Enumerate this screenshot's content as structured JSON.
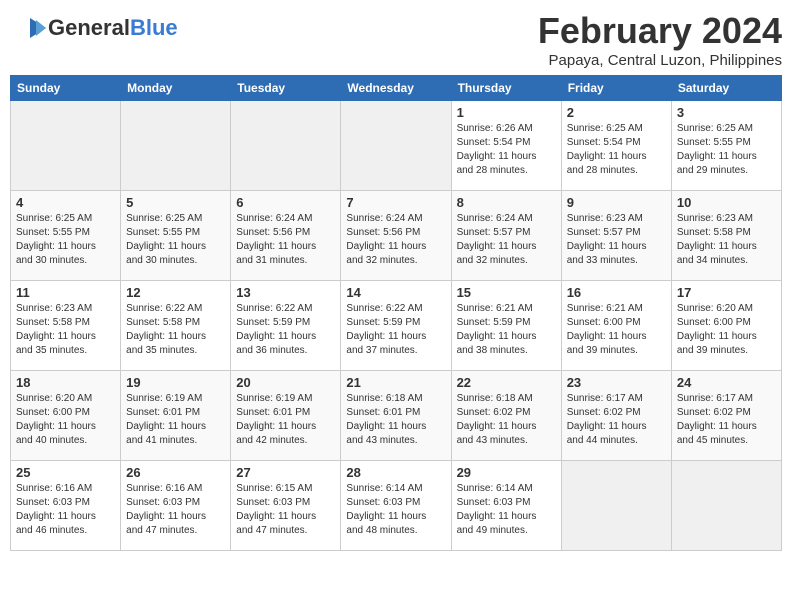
{
  "header": {
    "logo_general": "General",
    "logo_blue": "Blue",
    "month_title": "February 2024",
    "location": "Papaya, Central Luzon, Philippines"
  },
  "days_of_week": [
    "Sunday",
    "Monday",
    "Tuesday",
    "Wednesday",
    "Thursday",
    "Friday",
    "Saturday"
  ],
  "weeks": [
    [
      {
        "day": "",
        "sunrise": "",
        "sunset": "",
        "daylight": "",
        "empty": true
      },
      {
        "day": "",
        "sunrise": "",
        "sunset": "",
        "daylight": "",
        "empty": true
      },
      {
        "day": "",
        "sunrise": "",
        "sunset": "",
        "daylight": "",
        "empty": true
      },
      {
        "day": "",
        "sunrise": "",
        "sunset": "",
        "daylight": "",
        "empty": true
      },
      {
        "day": "1",
        "sunrise": "Sunrise: 6:26 AM",
        "sunset": "Sunset: 5:54 PM",
        "daylight": "Daylight: 11 hours and 28 minutes."
      },
      {
        "day": "2",
        "sunrise": "Sunrise: 6:25 AM",
        "sunset": "Sunset: 5:54 PM",
        "daylight": "Daylight: 11 hours and 28 minutes."
      },
      {
        "day": "3",
        "sunrise": "Sunrise: 6:25 AM",
        "sunset": "Sunset: 5:55 PM",
        "daylight": "Daylight: 11 hours and 29 minutes."
      }
    ],
    [
      {
        "day": "4",
        "sunrise": "Sunrise: 6:25 AM",
        "sunset": "Sunset: 5:55 PM",
        "daylight": "Daylight: 11 hours and 30 minutes."
      },
      {
        "day": "5",
        "sunrise": "Sunrise: 6:25 AM",
        "sunset": "Sunset: 5:55 PM",
        "daylight": "Daylight: 11 hours and 30 minutes."
      },
      {
        "day": "6",
        "sunrise": "Sunrise: 6:24 AM",
        "sunset": "Sunset: 5:56 PM",
        "daylight": "Daylight: 11 hours and 31 minutes."
      },
      {
        "day": "7",
        "sunrise": "Sunrise: 6:24 AM",
        "sunset": "Sunset: 5:56 PM",
        "daylight": "Daylight: 11 hours and 32 minutes."
      },
      {
        "day": "8",
        "sunrise": "Sunrise: 6:24 AM",
        "sunset": "Sunset: 5:57 PM",
        "daylight": "Daylight: 11 hours and 32 minutes."
      },
      {
        "day": "9",
        "sunrise": "Sunrise: 6:23 AM",
        "sunset": "Sunset: 5:57 PM",
        "daylight": "Daylight: 11 hours and 33 minutes."
      },
      {
        "day": "10",
        "sunrise": "Sunrise: 6:23 AM",
        "sunset": "Sunset: 5:58 PM",
        "daylight": "Daylight: 11 hours and 34 minutes."
      }
    ],
    [
      {
        "day": "11",
        "sunrise": "Sunrise: 6:23 AM",
        "sunset": "Sunset: 5:58 PM",
        "daylight": "Daylight: 11 hours and 35 minutes."
      },
      {
        "day": "12",
        "sunrise": "Sunrise: 6:22 AM",
        "sunset": "Sunset: 5:58 PM",
        "daylight": "Daylight: 11 hours and 35 minutes."
      },
      {
        "day": "13",
        "sunrise": "Sunrise: 6:22 AM",
        "sunset": "Sunset: 5:59 PM",
        "daylight": "Daylight: 11 hours and 36 minutes."
      },
      {
        "day": "14",
        "sunrise": "Sunrise: 6:22 AM",
        "sunset": "Sunset: 5:59 PM",
        "daylight": "Daylight: 11 hours and 37 minutes."
      },
      {
        "day": "15",
        "sunrise": "Sunrise: 6:21 AM",
        "sunset": "Sunset: 5:59 PM",
        "daylight": "Daylight: 11 hours and 38 minutes."
      },
      {
        "day": "16",
        "sunrise": "Sunrise: 6:21 AM",
        "sunset": "Sunset: 6:00 PM",
        "daylight": "Daylight: 11 hours and 39 minutes."
      },
      {
        "day": "17",
        "sunrise": "Sunrise: 6:20 AM",
        "sunset": "Sunset: 6:00 PM",
        "daylight": "Daylight: 11 hours and 39 minutes."
      }
    ],
    [
      {
        "day": "18",
        "sunrise": "Sunrise: 6:20 AM",
        "sunset": "Sunset: 6:00 PM",
        "daylight": "Daylight: 11 hours and 40 minutes."
      },
      {
        "day": "19",
        "sunrise": "Sunrise: 6:19 AM",
        "sunset": "Sunset: 6:01 PM",
        "daylight": "Daylight: 11 hours and 41 minutes."
      },
      {
        "day": "20",
        "sunrise": "Sunrise: 6:19 AM",
        "sunset": "Sunset: 6:01 PM",
        "daylight": "Daylight: 11 hours and 42 minutes."
      },
      {
        "day": "21",
        "sunrise": "Sunrise: 6:18 AM",
        "sunset": "Sunset: 6:01 PM",
        "daylight": "Daylight: 11 hours and 43 minutes."
      },
      {
        "day": "22",
        "sunrise": "Sunrise: 6:18 AM",
        "sunset": "Sunset: 6:02 PM",
        "daylight": "Daylight: 11 hours and 43 minutes."
      },
      {
        "day": "23",
        "sunrise": "Sunrise: 6:17 AM",
        "sunset": "Sunset: 6:02 PM",
        "daylight": "Daylight: 11 hours and 44 minutes."
      },
      {
        "day": "24",
        "sunrise": "Sunrise: 6:17 AM",
        "sunset": "Sunset: 6:02 PM",
        "daylight": "Daylight: 11 hours and 45 minutes."
      }
    ],
    [
      {
        "day": "25",
        "sunrise": "Sunrise: 6:16 AM",
        "sunset": "Sunset: 6:03 PM",
        "daylight": "Daylight: 11 hours and 46 minutes."
      },
      {
        "day": "26",
        "sunrise": "Sunrise: 6:16 AM",
        "sunset": "Sunset: 6:03 PM",
        "daylight": "Daylight: 11 hours and 47 minutes."
      },
      {
        "day": "27",
        "sunrise": "Sunrise: 6:15 AM",
        "sunset": "Sunset: 6:03 PM",
        "daylight": "Daylight: 11 hours and 47 minutes."
      },
      {
        "day": "28",
        "sunrise": "Sunrise: 6:14 AM",
        "sunset": "Sunset: 6:03 PM",
        "daylight": "Daylight: 11 hours and 48 minutes."
      },
      {
        "day": "29",
        "sunrise": "Sunrise: 6:14 AM",
        "sunset": "Sunset: 6:03 PM",
        "daylight": "Daylight: 11 hours and 49 minutes."
      },
      {
        "day": "",
        "sunrise": "",
        "sunset": "",
        "daylight": "",
        "empty": true
      },
      {
        "day": "",
        "sunrise": "",
        "sunset": "",
        "daylight": "",
        "empty": true
      }
    ]
  ]
}
